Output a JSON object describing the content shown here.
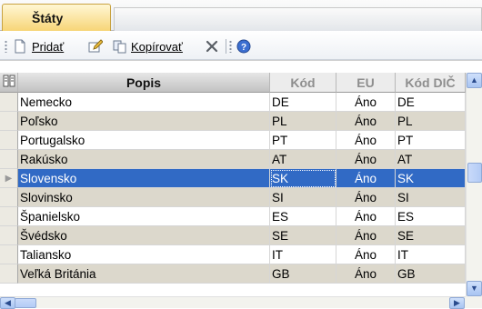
{
  "tabs": {
    "active": "Štáty"
  },
  "toolbar": {
    "add_label": "Pridať",
    "copy_label": "Kopírovať"
  },
  "columns": {
    "popis": "Popis",
    "kod": "Kód",
    "eu": "EU",
    "kod_dic": "Kód DIČ"
  },
  "rows": [
    {
      "popis": "Nemecko",
      "kod": "DE",
      "eu": "Áno",
      "kod_dic": "DE"
    },
    {
      "popis": "Poľsko",
      "kod": "PL",
      "eu": "Áno",
      "kod_dic": "PL"
    },
    {
      "popis": "Portugalsko",
      "kod": "PT",
      "eu": "Áno",
      "kod_dic": "PT"
    },
    {
      "popis": "Rakúsko",
      "kod": "AT",
      "eu": "Áno",
      "kod_dic": "AT"
    },
    {
      "popis": "Slovensko",
      "kod": "SK",
      "eu": "Áno",
      "kod_dic": "SK"
    },
    {
      "popis": "Slovinsko",
      "kod": "SI",
      "eu": "Áno",
      "kod_dic": "SI"
    },
    {
      "popis": "Španielsko",
      "kod": "ES",
      "eu": "Áno",
      "kod_dic": "ES"
    },
    {
      "popis": "Švédsko",
      "kod": "SE",
      "eu": "Áno",
      "kod_dic": "SE"
    },
    {
      "popis": "Taliansko",
      "kod": "IT",
      "eu": "Áno",
      "kod_dic": "IT"
    },
    {
      "popis": "Veľká Británia",
      "kod": "GB",
      "eu": "Áno",
      "kod_dic": "GB"
    }
  ],
  "selected_row": 4,
  "icons": {
    "new": "new-document-icon",
    "edit": "edit-icon",
    "copy": "copy-icon",
    "delete": "delete-icon",
    "help": "help-icon",
    "column_chooser": "column-chooser-icon",
    "row_indicator": "row-pointer-icon"
  },
  "colors": {
    "selection": "#316ac5",
    "alt_row": "#dcd8cc",
    "tab_active": "#f7d577"
  }
}
